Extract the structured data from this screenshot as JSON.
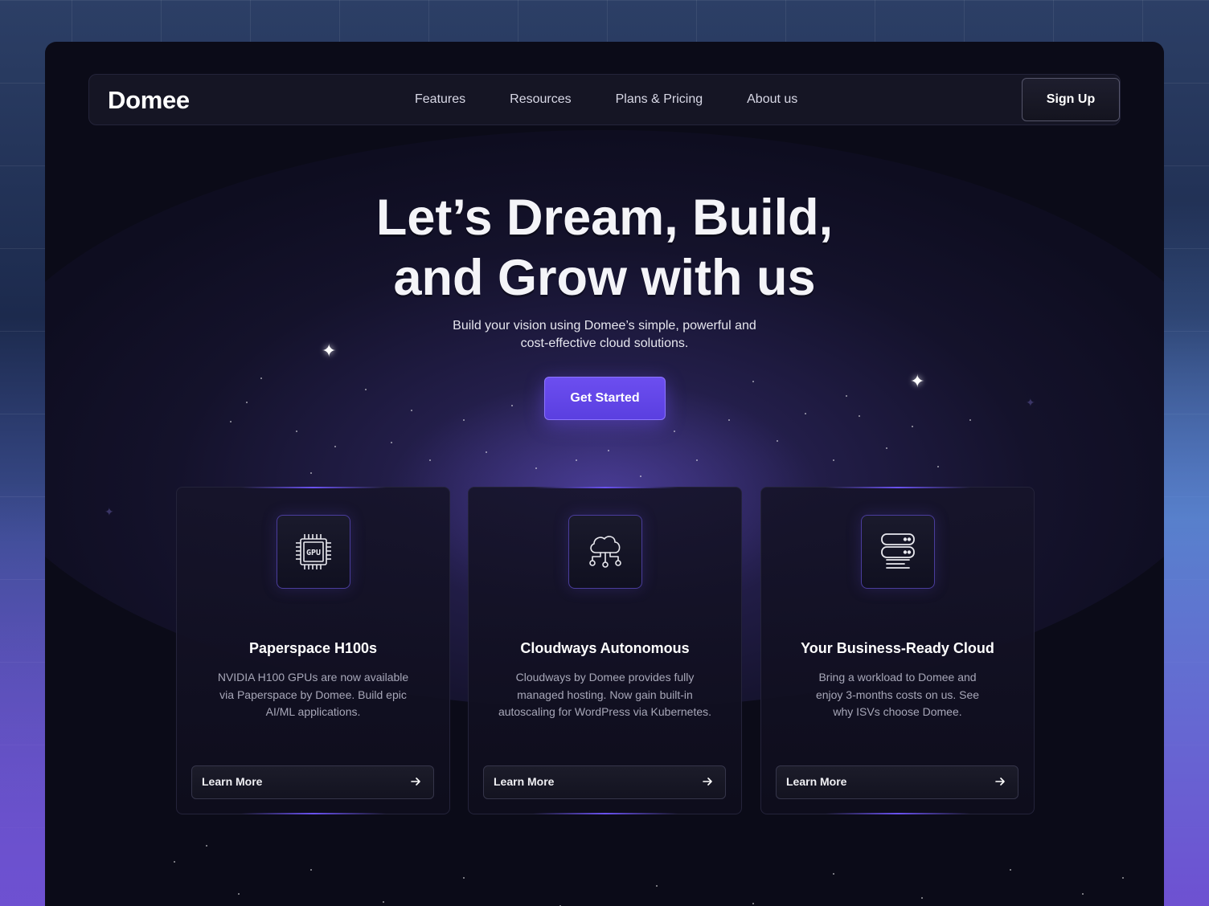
{
  "brand": {
    "name": "Domee",
    "accent": "#6c4ef0"
  },
  "nav": {
    "links": [
      "Features",
      "Resources",
      "Plans & Pricing",
      "About us"
    ],
    "signup_label": "Sign Up"
  },
  "hero": {
    "title_line1": "Let’s Dream, Build,",
    "title_line2": "and Grow with us",
    "subtitle_line1": "Build your vision using Domee’s simple, powerful and",
    "subtitle_line2": "cost-effective cloud solutions.",
    "cta_label": "Get Started"
  },
  "cards": [
    {
      "icon": "gpu-chip-icon",
      "icon_text": "GPU",
      "title": "Paperspace H100s",
      "desc_line1": "NVIDIA H100 GPUs are now available",
      "desc_line2": "via Paperspace by Domee. Build epic",
      "desc_line3": "AI/ML applications.",
      "button": "Learn More"
    },
    {
      "icon": "cloud-network-icon",
      "title": "Cloudways Autonomous",
      "desc_line1": "Cloudways by Domee provides fully",
      "desc_line2": "managed hosting. Now gain built-in",
      "desc_line3": "autoscaling for WordPress via Kubernetes.",
      "button": "Learn More"
    },
    {
      "icon": "server-stack-icon",
      "title": "Your Business-Ready Cloud",
      "desc_line1": "Bring a workload to Domee and",
      "desc_line2": "enjoy 3-months costs on us. See",
      "desc_line3": "why ISVs choose Domee.",
      "button": "Learn More"
    }
  ]
}
